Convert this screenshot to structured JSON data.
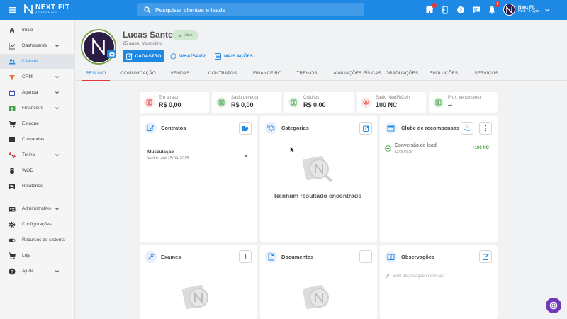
{
  "app": {
    "logo_main": "NEXT FIT",
    "logo_sub": "ACADEMIAS",
    "search_placeholder": "Pesquisar clientes e leads",
    "notification_count": "9",
    "user_name": "Next Fit",
    "user_gym": "Next Fit Gym",
    "accent_color": "#1e88e5"
  },
  "sidebar": {
    "items": [
      {
        "label": "Início",
        "icon": "home-icon"
      },
      {
        "label": "Dashboards",
        "icon": "chart-line-icon"
      },
      {
        "label": "Clientes",
        "icon": "users-icon"
      },
      {
        "label": "CRM",
        "icon": "crm-icon"
      },
      {
        "label": "Agenda",
        "icon": "calendar-icon"
      },
      {
        "label": "Financeiro",
        "icon": "money-icon"
      },
      {
        "label": "Estoque",
        "icon": "cart-icon"
      },
      {
        "label": "Comandas",
        "icon": "receipt-icon"
      },
      {
        "label": "Treino",
        "icon": "dumbbell-icon"
      },
      {
        "label": "WOD",
        "icon": "kettlebell-icon"
      },
      {
        "label": "Relatórios",
        "icon": "report-icon"
      },
      {
        "label": "Administrativo",
        "icon": "id-card-icon"
      },
      {
        "label": "Configurações",
        "icon": "gear-icon"
      },
      {
        "label": "Recursos do sistema",
        "icon": "toggle-icon"
      },
      {
        "label": "Loja",
        "icon": "store-icon"
      },
      {
        "label": "Ajuda",
        "icon": "help-icon"
      }
    ]
  },
  "client": {
    "name": "Lucas Santos",
    "status": "Ativo",
    "info": "25 anos, Masculino"
  },
  "actions": {
    "cadastro": "CADASTRO",
    "whatsapp": "WHATSAPP",
    "mais_acoes": "MAIS AÇÕES"
  },
  "tabs": [
    "RESUMO",
    "COMUNICAÇÃO",
    "VENDAS",
    "CONTRATOS",
    "FINANCEIRO",
    "TREINOS",
    "AVALIAÇÕES FÍSICAS",
    "GRADUAÇÕES",
    "EVOLUÇÕES",
    "SERVIÇOS"
  ],
  "stats": [
    {
      "label": "Em atraso",
      "value": "R$ 0,00",
      "color": "#e53935"
    },
    {
      "label": "Saldo devedor",
      "value": "R$ 0,00",
      "color": "#43a047"
    },
    {
      "label": "Créditos",
      "value": "R$ 0,00",
      "color": "#43a047"
    },
    {
      "label": "Saldo NextFitCoin",
      "value": "100 NC",
      "color": "#e53935"
    },
    {
      "label": "Próx. vencimento",
      "value": "--",
      "color": "#43a047"
    }
  ],
  "contratos": {
    "title": "Contratos",
    "item_name": "Musculação",
    "item_valid": "Válido até 25/09/2025"
  },
  "categorias": {
    "title": "Categorias",
    "empty": "Nenhum resultado encontrado"
  },
  "clube": {
    "title": "Clube de recompensas",
    "item_title": "Conversão de lead",
    "item_date": "13/06/2025",
    "item_points": "+100 NC"
  },
  "exames": {
    "title": "Exames"
  },
  "documentos": {
    "title": "Documentos"
  },
  "observacoes": {
    "title": "Observações",
    "empty": "Sem observação informada"
  }
}
